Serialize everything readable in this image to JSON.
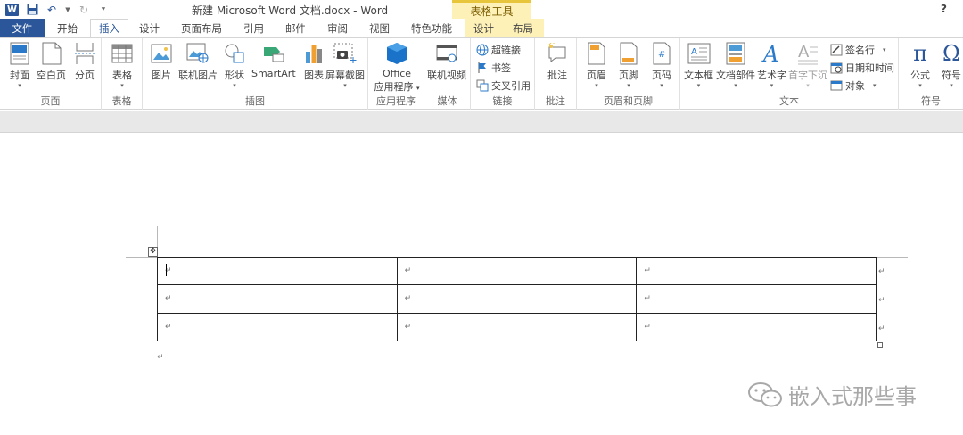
{
  "titlebar": {
    "doc_title": "新建 Microsoft Word 文档.docx - Word",
    "context_tab_header": "表格工具",
    "help": "?"
  },
  "tabs": [
    {
      "label": "文件"
    },
    {
      "label": "开始"
    },
    {
      "label": "插入"
    },
    {
      "label": "设计"
    },
    {
      "label": "页面布局"
    },
    {
      "label": "引用"
    },
    {
      "label": "邮件"
    },
    {
      "label": "审阅"
    },
    {
      "label": "视图"
    },
    {
      "label": "特色功能"
    },
    {
      "label": "设计"
    },
    {
      "label": "布局"
    }
  ],
  "ribbon": {
    "pages": {
      "cover": "封面",
      "blank": "空白页",
      "break": "分页",
      "group": "页面"
    },
    "tables": {
      "table": "表格",
      "group": "表格"
    },
    "illustrations": {
      "picture": "图片",
      "online_picture": "联机图片",
      "shapes": "形状",
      "smartart": "SmartArt",
      "chart": "图表",
      "screenshot": "屏幕截图",
      "group": "插图"
    },
    "apps": {
      "office_line1": "Office",
      "office_line2": "应用程序",
      "group": "应用程序"
    },
    "media": {
      "online_video": "联机视频",
      "group": "媒体"
    },
    "links": {
      "hyperlink": "超链接",
      "bookmark": "书签",
      "crossref": "交叉引用",
      "group": "链接"
    },
    "comments": {
      "comment": "批注",
      "group": "批注"
    },
    "header_footer": {
      "header": "页眉",
      "footer": "页脚",
      "page_number": "页码",
      "group": "页眉和页脚"
    },
    "text": {
      "textbox": "文本框",
      "quickparts": "文档部件",
      "wordart": "艺术字",
      "dropcap": "首字下沉",
      "signature": "签名行",
      "datetime": "日期和时间",
      "object": "对象",
      "group": "文本"
    },
    "symbols": {
      "equation": "公式",
      "symbol": "符号",
      "group": "符号"
    }
  },
  "document": {
    "table_rows": [
      [
        "↵",
        "↵",
        "↵"
      ],
      [
        "↵",
        "↵",
        "↵"
      ],
      [
        "↵",
        "↵",
        "↵"
      ]
    ],
    "row_end_mark": "↵",
    "after_table_mark": "↵",
    "move_handle_glyph": "✥"
  },
  "watermark": {
    "text": "嵌入式那些事"
  },
  "colors": {
    "word_blue": "#2b579a",
    "context_yellow": "#fdf1b7"
  }
}
